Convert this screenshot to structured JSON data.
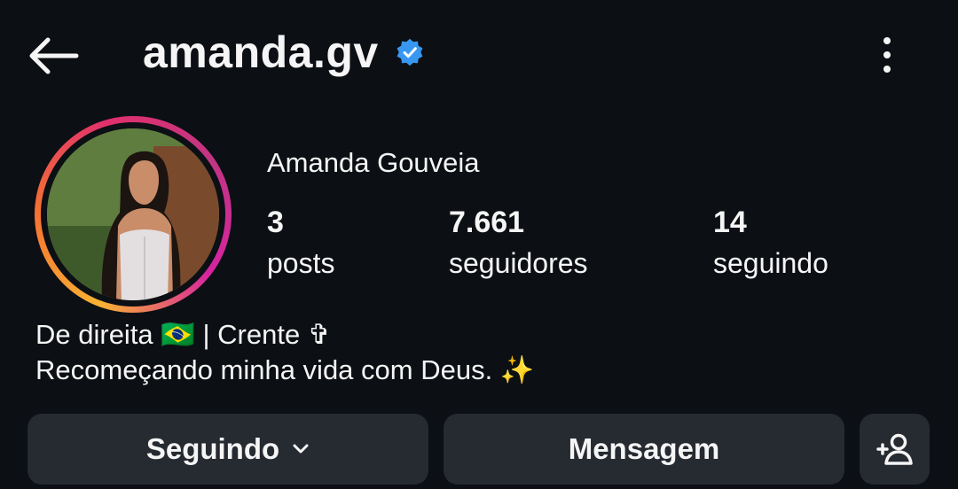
{
  "header": {
    "username": "amanda.gv",
    "icons": {
      "back": "back-arrow-icon",
      "verified": "verified-badge-icon",
      "more": "more-vertical-icon"
    }
  },
  "profile": {
    "display_name": "Amanda Gouveia",
    "stats": [
      {
        "value": "3",
        "label": "posts"
      },
      {
        "value": "7.661",
        "label": "seguidores"
      },
      {
        "value": "14",
        "label": "seguindo"
      }
    ],
    "bio": [
      "De direita 🇧🇷 | Crente ✞",
      "Recomeçando minha vida com Deus. ✨"
    ]
  },
  "actions": {
    "following_label": "Seguindo",
    "message_label": "Mensagem",
    "icons": {
      "following": "chevron-down-icon",
      "suggest": "add-person-icon"
    }
  },
  "colors": {
    "background": "#0c0f14",
    "button": "#262a31",
    "verified": "#3897f0",
    "ring": [
      "#f9b233",
      "#e1306c",
      "#c13584"
    ]
  }
}
